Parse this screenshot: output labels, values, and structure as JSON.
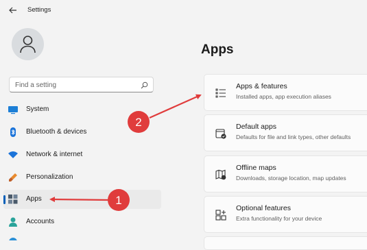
{
  "window": {
    "title": "Settings"
  },
  "search": {
    "placeholder": "Find a setting"
  },
  "sidebar": {
    "items": [
      {
        "label": "System",
        "icon": "system-icon"
      },
      {
        "label": "Bluetooth & devices",
        "icon": "bluetooth-icon"
      },
      {
        "label": "Network & internet",
        "icon": "wifi-icon"
      },
      {
        "label": "Personalization",
        "icon": "brush-icon"
      },
      {
        "label": "Apps",
        "icon": "apps-icon",
        "selected": true
      },
      {
        "label": "Accounts",
        "icon": "person-icon"
      }
    ]
  },
  "main": {
    "title": "Apps",
    "cards": [
      {
        "title": "Apps & features",
        "subtitle": "Installed apps, app execution aliases",
        "icon": "list-icon"
      },
      {
        "title": "Default apps",
        "subtitle": "Defaults for file and link types, other defaults",
        "icon": "default-apps-icon"
      },
      {
        "title": "Offline maps",
        "subtitle": "Downloads, storage location, map updates",
        "icon": "map-icon"
      },
      {
        "title": "Optional features",
        "subtitle": "Extra functionality for your device",
        "icon": "optional-features-icon"
      }
    ]
  },
  "annotations": [
    {
      "number": "1",
      "color": "#e03c3c"
    },
    {
      "number": "2",
      "color": "#e03c3c"
    }
  ],
  "colors": {
    "accent": "#005fb8",
    "annotation": "#e03c3c",
    "background": "#f3f3f3"
  }
}
